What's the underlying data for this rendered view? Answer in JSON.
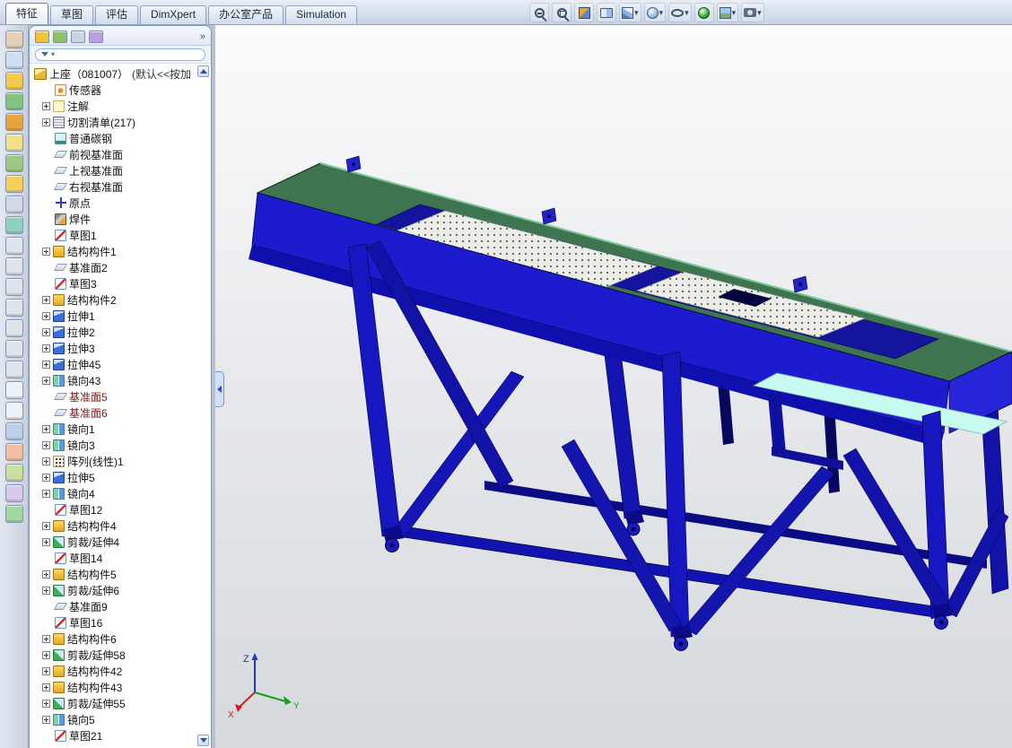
{
  "command_tabs": {
    "items": [
      {
        "id": "features",
        "label": "特征",
        "active": true
      },
      {
        "id": "sketch",
        "label": "草图",
        "active": false
      },
      {
        "id": "evaluate",
        "label": "评估",
        "active": false
      },
      {
        "id": "dimxpert",
        "label": "DimXpert",
        "active": false
      },
      {
        "id": "office-products",
        "label": "办公室产品",
        "active": false
      },
      {
        "id": "simulation",
        "label": "Simulation",
        "active": false
      }
    ]
  },
  "view_toolbar": {
    "buttons": [
      {
        "name": "zoom-in",
        "icon": "mag-plus",
        "dropdown": false
      },
      {
        "name": "zoom-to-area",
        "icon": "mag-area",
        "dropdown": false
      },
      {
        "name": "section-view",
        "icon": "section",
        "dropdown": false
      },
      {
        "name": "view-settings",
        "icon": "book",
        "dropdown": false
      },
      {
        "name": "view-orientation",
        "icon": "cube",
        "dropdown": true
      },
      {
        "name": "display-style",
        "icon": "displaystyle",
        "dropdown": true
      },
      {
        "name": "hide-show-items",
        "icon": "eye",
        "dropdown": true
      },
      {
        "name": "edit-appearance",
        "icon": "ball",
        "dropdown": false
      },
      {
        "name": "apply-scene",
        "icon": "scene",
        "dropdown": true
      },
      {
        "name": "camera-views",
        "icon": "camera",
        "dropdown": true
      }
    ]
  },
  "left_toolbar": {
    "icons": [
      {
        "name": "sketch",
        "color": "#e8d0b8"
      },
      {
        "name": "smart-dimension",
        "color": "#cfe0f4"
      },
      {
        "name": "extrude-boss",
        "color": "#f4c84a"
      },
      {
        "name": "extrude-cut",
        "color": "#7fc77f"
      },
      {
        "name": "revolve",
        "color": "#e8a33d"
      },
      {
        "name": "fillet",
        "color": "#f0e28a"
      },
      {
        "name": "linear-pattern",
        "color": "#9fc77f"
      },
      {
        "name": "mirror",
        "color": "#f4d05a"
      },
      {
        "name": "reference-plane",
        "color": "#cfd8e6"
      },
      {
        "name": "helix",
        "color": "#8fd0c0"
      },
      {
        "name": "front-view",
        "color": "#dfe3ea"
      },
      {
        "name": "back-view",
        "color": "#dfe3ea"
      },
      {
        "name": "left-view",
        "color": "#dfe3ea"
      },
      {
        "name": "right-view",
        "color": "#dfe3ea"
      },
      {
        "name": "top-view",
        "color": "#dfe3ea"
      },
      {
        "name": "bottom-view",
        "color": "#dfe3ea"
      },
      {
        "name": "isometric-view",
        "color": "#dfe3ea"
      },
      {
        "name": "wireframe",
        "color": "#eef1f6"
      },
      {
        "name": "hidden-lines-visible",
        "color": "#eef1f6"
      },
      {
        "name": "shaded-with-edges",
        "color": "#bcd0ea"
      },
      {
        "name": "section-display",
        "color": "#f0c0a0"
      },
      {
        "name": "measure",
        "color": "#c8e0a0"
      },
      {
        "name": "mass-properties",
        "color": "#d8c8ea"
      },
      {
        "name": "appearance",
        "color": "#a0d8a0"
      }
    ]
  },
  "feature_manager": {
    "header_icons": [
      {
        "name": "featuremanager",
        "color": "#f2c33c"
      },
      {
        "name": "propertymanager",
        "color": "#8fbe6a"
      },
      {
        "name": "configurationmanager",
        "color": "#c9d4e4"
      },
      {
        "name": "dimxpertmanager",
        "color": "#b79fe0"
      }
    ],
    "overflow_glyph": "»",
    "root": {
      "label": "上座（081007）",
      "config_suffix": "(默认<<按加"
    },
    "items": [
      {
        "icon": "sensors",
        "label": "传感器",
        "expandable": false
      },
      {
        "icon": "annotations",
        "label": "注解",
        "expandable": true
      },
      {
        "icon": "cut-list",
        "label": "切割清单(217)",
        "expandable": true
      },
      {
        "icon": "material",
        "label": "普通碳钢",
        "expandable": false
      },
      {
        "icon": "plane",
        "label": "前视基准面",
        "expandable": false
      },
      {
        "icon": "plane",
        "label": "上视基准面",
        "expandable": false
      },
      {
        "icon": "plane",
        "label": "右视基准面",
        "expandable": false
      },
      {
        "icon": "origin",
        "label": "原点",
        "expandable": false
      },
      {
        "icon": "weldment",
        "label": "焊件",
        "expandable": false
      },
      {
        "icon": "sketch",
        "label": "草图1",
        "expandable": false
      },
      {
        "icon": "structural-member",
        "label": "结构构件1",
        "expandable": true
      },
      {
        "icon": "plane",
        "label": "基准面2",
        "expandable": false
      },
      {
        "icon": "sketch",
        "label": "草图3",
        "expandable": false
      },
      {
        "icon": "structural-member",
        "label": "结构构件2",
        "expandable": true
      },
      {
        "icon": "extrude",
        "label": "拉伸1",
        "expandable": true
      },
      {
        "icon": "extrude",
        "label": "拉伸2",
        "expandable": true
      },
      {
        "icon": "extrude",
        "label": "拉伸3",
        "expandable": true
      },
      {
        "icon": "extrude",
        "label": "拉伸45",
        "expandable": true
      },
      {
        "icon": "mirror",
        "label": "镜向43",
        "expandable": true
      },
      {
        "icon": "plane",
        "label": "基准面5",
        "expandable": false,
        "color": "#7b1a1a"
      },
      {
        "icon": "plane",
        "label": "基准面6",
        "expandable": false,
        "color": "#7b1a1a"
      },
      {
        "icon": "mirror",
        "label": "镜向1",
        "expandable": true
      },
      {
        "icon": "mirror",
        "label": "镜向3",
        "expandable": true
      },
      {
        "icon": "linear-pattern",
        "label": "阵列(线性)1",
        "expandable": true
      },
      {
        "icon": "extrude",
        "label": "拉伸5",
        "expandable": true
      },
      {
        "icon": "mirror",
        "label": "镜向4",
        "expandable": true
      },
      {
        "icon": "sketch",
        "label": "草图12",
        "expandable": false
      },
      {
        "icon": "structural-member",
        "label": "结构构件4",
        "expandable": true
      },
      {
        "icon": "trim-extend",
        "label": "剪裁/延伸4",
        "expandable": true
      },
      {
        "icon": "sketch",
        "label": "草图14",
        "expandable": false
      },
      {
        "icon": "structural-member",
        "label": "结构构件5",
        "expandable": true
      },
      {
        "icon": "trim-extend",
        "label": "剪裁/延伸6",
        "expandable": true
      },
      {
        "icon": "plane",
        "label": "基准面9",
        "expandable": false
      },
      {
        "icon": "sketch",
        "label": "草图16",
        "expandable": false
      },
      {
        "icon": "structural-member",
        "label": "结构构件6",
        "expandable": true
      },
      {
        "icon": "trim-extend",
        "label": "剪裁/延伸58",
        "expandable": true
      },
      {
        "icon": "structural-member",
        "label": "结构构件42",
        "expandable": true
      },
      {
        "icon": "structural-member",
        "label": "结构构件43",
        "expandable": true
      },
      {
        "icon": "trim-extend",
        "label": "剪裁/延伸55",
        "expandable": true
      },
      {
        "icon": "mirror",
        "label": "镜向5",
        "expandable": true
      },
      {
        "icon": "sketch",
        "label": "草图21",
        "expandable": false
      }
    ]
  },
  "triad": {
    "x": "X",
    "y": "Y",
    "z": "Z"
  },
  "colors": {
    "frame_blue": "#1c1cce",
    "frame_blue_dark": "#0f0fae",
    "deck_green": "#3f7450",
    "plate_white": "#edede6",
    "highlight_cyan": "#c8fbef",
    "viewport_top": "#fafbfc",
    "viewport_bottom": "#d6d9dd"
  }
}
